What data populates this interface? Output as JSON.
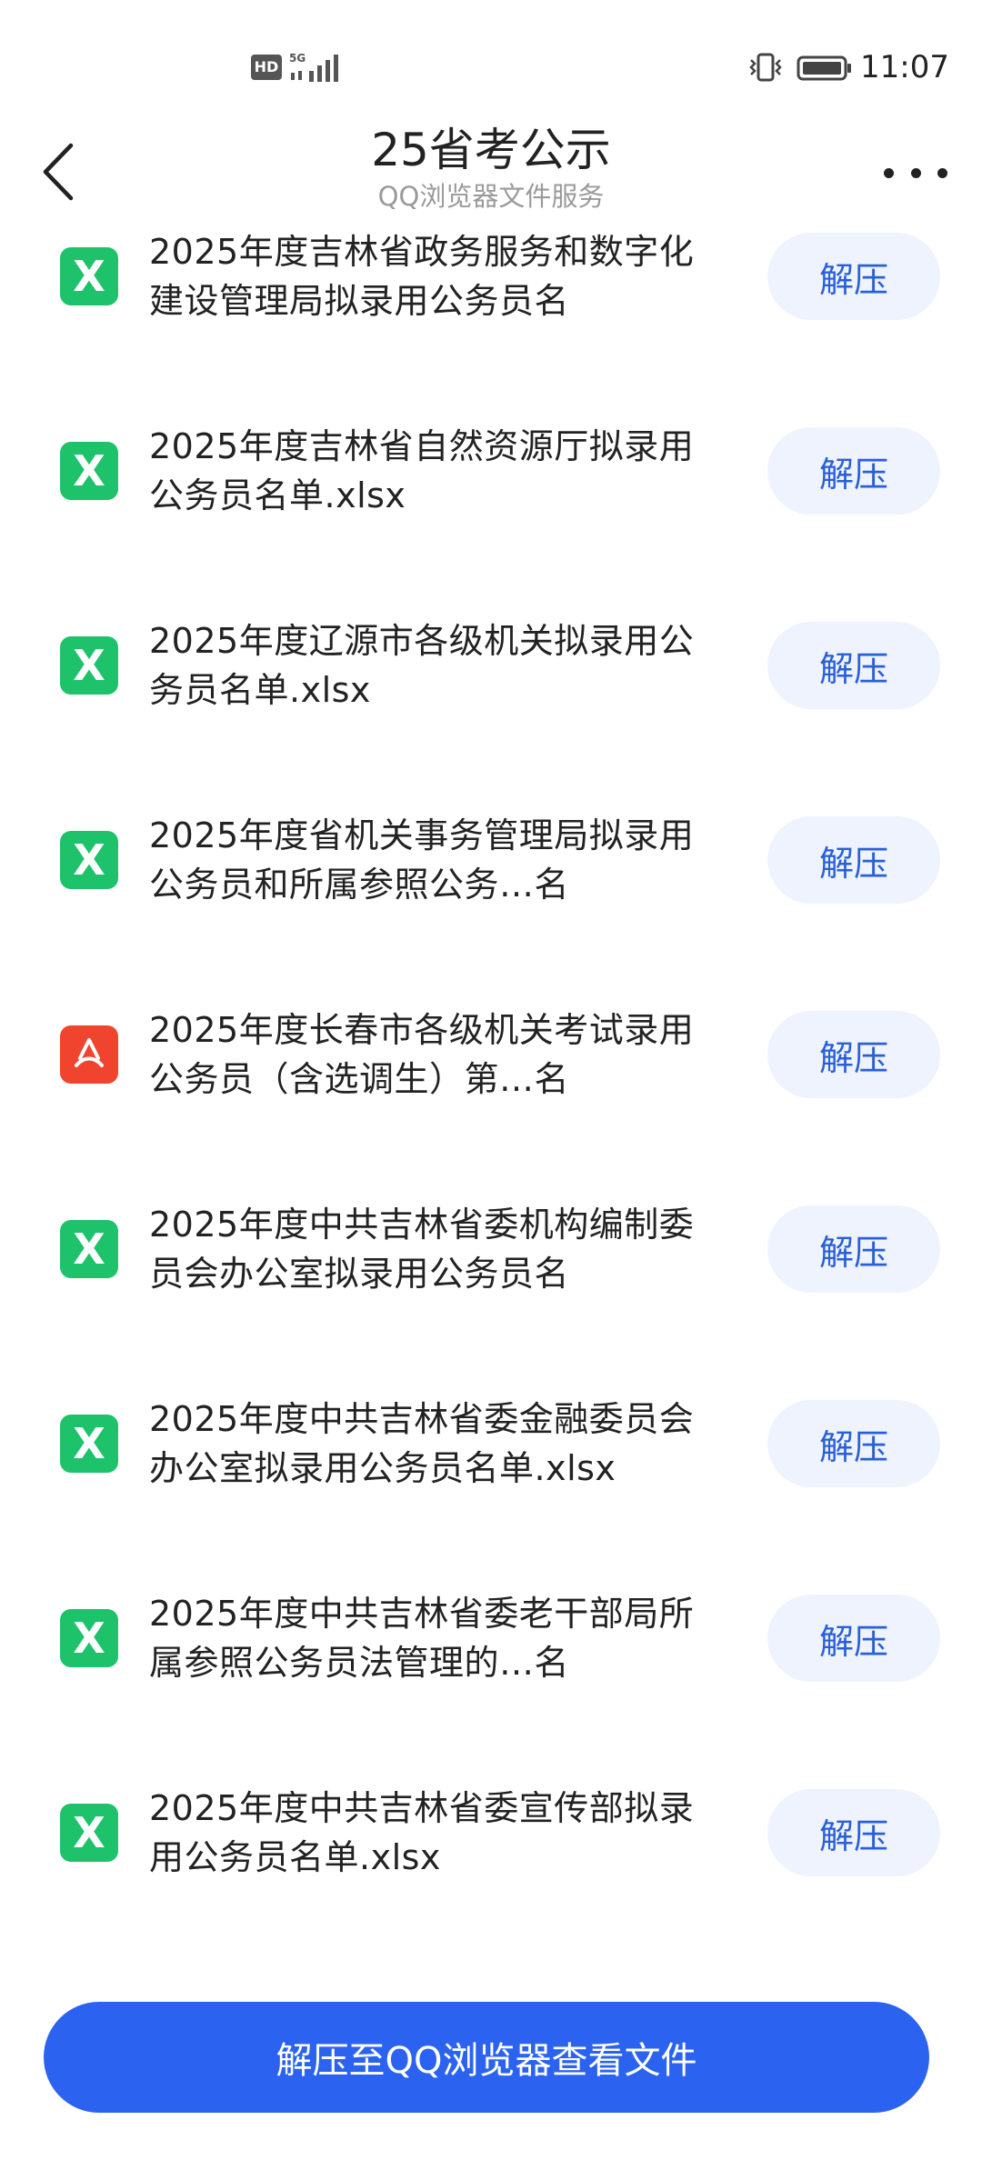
{
  "status_bar": {
    "hd_label": "HD",
    "network_label": "5G",
    "time": "11:07"
  },
  "header": {
    "title": "25省考公示",
    "subtitle": "QQ浏览器文件服务",
    "back_icon": "chevron-left-icon",
    "more_icon": "more-horizontal-icon"
  },
  "files": [
    {
      "name": "2025年度吉林省政务服务和数字化建设管理局拟录用公务员名",
      "type": "xlsx",
      "icon": "excel-icon",
      "action": "解压"
    },
    {
      "name": "2025年度吉林省自然资源厅拟录用公务员名单.xlsx",
      "type": "xlsx",
      "icon": "excel-icon",
      "action": "解压"
    },
    {
      "name": "2025年度辽源市各级机关拟录用公务员名单.xlsx",
      "type": "xlsx",
      "icon": "excel-icon",
      "action": "解压"
    },
    {
      "name": "2025年度省机关事务管理局拟录用公务员和所属参照公务…名",
      "type": "xlsx",
      "icon": "excel-icon",
      "action": "解压"
    },
    {
      "name": "2025年度长春市各级机关考试录用公务员（含选调生）第…名",
      "type": "pdf",
      "icon": "pdf-icon",
      "action": "解压"
    },
    {
      "name": "2025年度中共吉林省委机构编制委员会办公室拟录用公务员名",
      "type": "xlsx",
      "icon": "excel-icon",
      "action": "解压"
    },
    {
      "name": "2025年度中共吉林省委金融委员会办公室拟录用公务员名单.xlsx",
      "type": "xlsx",
      "icon": "excel-icon",
      "action": "解压"
    },
    {
      "name": "2025年度中共吉林省委老干部局所属参照公务员法管理的…名",
      "type": "xlsx",
      "icon": "excel-icon",
      "action": "解压"
    },
    {
      "name": "2025年度中共吉林省委宣传部拟录用公务员名单.xlsx",
      "type": "xlsx",
      "icon": "excel-icon",
      "action": "解压"
    }
  ],
  "bottom_action": {
    "label": "解压至QQ浏览器查看文件",
    "color": "#2b63f0"
  },
  "colors": {
    "excel": "#1ec26a",
    "pdf": "#f0442f",
    "unzip_bg": "#eef3fd",
    "unzip_text": "#2a5fd8"
  }
}
